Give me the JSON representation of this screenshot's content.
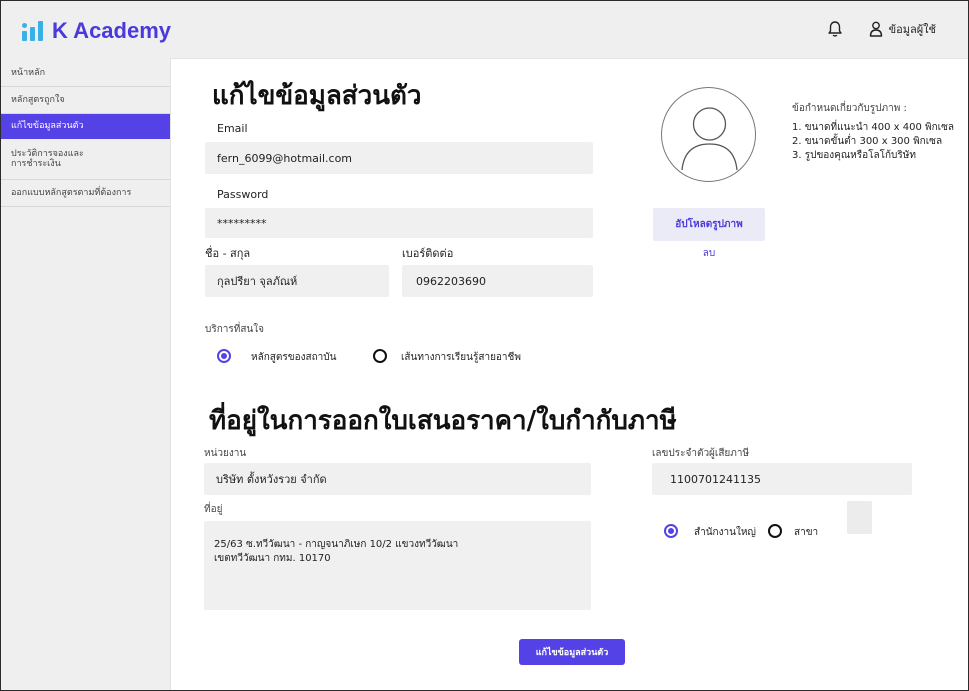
{
  "header": {
    "brand": "K Academy",
    "user_label": "ข้อมูลผู้ใช้"
  },
  "sidebar": {
    "items": [
      {
        "label": "หน้าหลัก"
      },
      {
        "label": "หลักสูตรถูกใจ"
      },
      {
        "label": "แก้ไขข้อมูลส่วนตัว"
      },
      {
        "label_line1": "ประวัติการจองและ",
        "label_line2": "การชำระเงิน"
      },
      {
        "label": "ออกแบบหลักสูตรตามที่ต้องการ"
      }
    ]
  },
  "profile": {
    "title": "แก้ไขข้อมูลส่วนตัว",
    "email_label": "Email",
    "email_value": "fern_6099@hotmail.com",
    "password_label": "Password",
    "password_value": "*********",
    "name_label": "ชื่อ - สกุล",
    "name_value": "กุลปรียา จุลภัณห์",
    "phone_label": "เบอร์ติดต่อ",
    "phone_value": "0962203690",
    "upload_button": "อัปโหลดรูปภาพ",
    "delete_link": "ลบ",
    "photo_requirements": {
      "title": "ข้อกำหนดเกี่ยวกับรูปภาพ :",
      "items": [
        "1. ขนาดที่แนะนำ 400 x 400 พิกเซล",
        "2. ขนาดขั้นต่ำ 300 x 300 พิกเซล",
        "3. รูปของคุณหรือโลโก้บริษัท"
      ]
    },
    "interest_label": "บริการที่สนใจ",
    "interest_options": [
      {
        "label": "หลักสูตรของสถาบัน",
        "selected": true
      },
      {
        "label": "เส้นทางการเรียนรู้สายอาชีพ",
        "selected": false
      }
    ]
  },
  "billing": {
    "title": "ที่อยู่ในการออกใบเสนอราคา/ใบกำกับภาษี",
    "org_label": "หน่วยงาน",
    "org_value": "บริษัท ตั้งหวังรวย จำกัด",
    "address_label": "ที่อยู่",
    "address_line1": "25/63 ซ.ทวีวัฒนา - กาญจนาภิเษก 10/2 แขวงทวีวัฒนา",
    "address_line2": "เขตทวีวัฒนา กทม. 10170",
    "tax_id_label": "เลขประจำตัวผู้เสียภาษี",
    "tax_id_value": "1100701241135",
    "branch_options": [
      {
        "label": "สำนักงานใหญ่",
        "selected": true
      },
      {
        "label": "สาขา",
        "selected": false
      }
    ],
    "branch_code": ""
  },
  "submit_button": "แก้ไขข้อมูลส่วนตัว",
  "colors": {
    "accent": "#5442e6",
    "brand_text": "#4a3adb",
    "logo": "#3ab0e6",
    "field_bg": "#f0f0f0",
    "sidebar_bg": "#efefef"
  }
}
